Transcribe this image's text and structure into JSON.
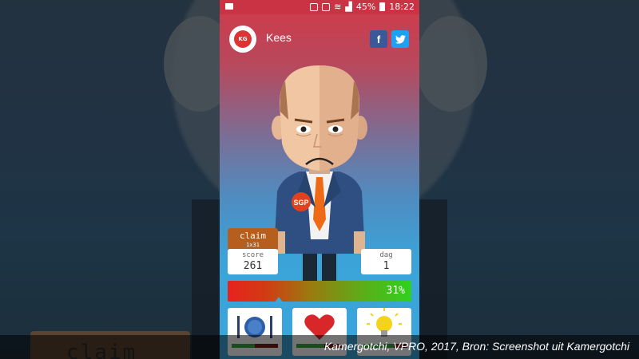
{
  "status_bar": {
    "battery": "45%",
    "time": "18:22"
  },
  "header": {
    "name": "Kees",
    "avatar_text": "KG",
    "facebook": "f",
    "twitter": "t"
  },
  "character": {
    "badge": "SGP"
  },
  "claim": {
    "label": "claim",
    "sub": "1x31"
  },
  "score": {
    "label": "score",
    "value": "261"
  },
  "day": {
    "label": "dag",
    "value": "1"
  },
  "progress": {
    "value": 0.31,
    "label": "31%"
  },
  "actions": [
    {
      "name": "food",
      "icon": "plate-icon",
      "level": 0.5
    },
    {
      "name": "love",
      "icon": "heart-icon",
      "level": 0.6
    },
    {
      "name": "idea",
      "icon": "lightbulb-icon",
      "level": 0.7
    }
  ],
  "background": {
    "claim": "claim"
  },
  "caption": "Kamergotchi, VPRO, 2017, Bron: Screenshot uit Kamergotchi"
}
